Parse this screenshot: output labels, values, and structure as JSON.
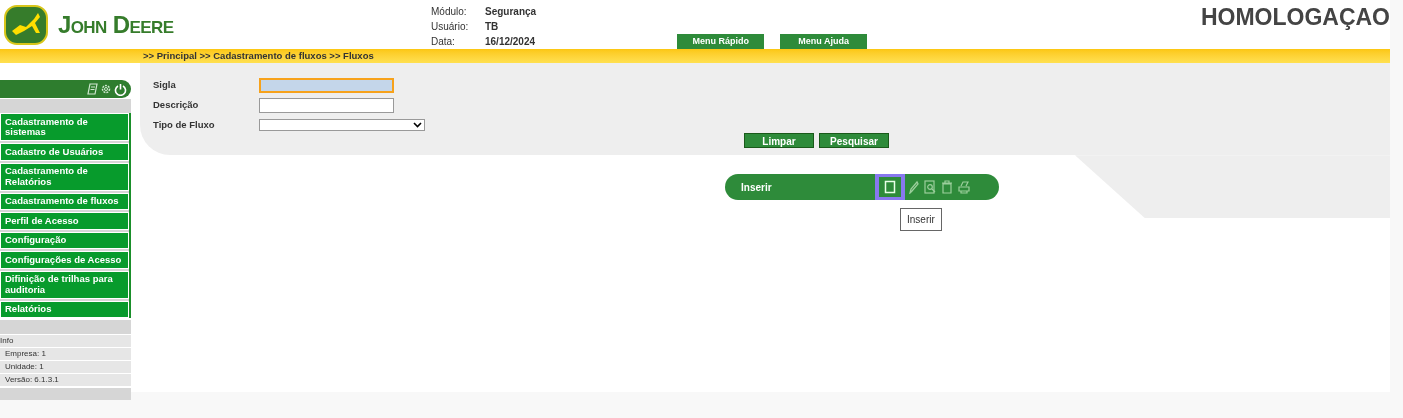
{
  "header": {
    "brand": "John Deere",
    "env": "HOMOLOGAÇAO",
    "info": [
      {
        "label": "Módulo:",
        "value": "Segurança"
      },
      {
        "label": "Usuário:",
        "value": "TB"
      },
      {
        "label": "Data:",
        "value": "16/12/2024"
      }
    ],
    "buttons": [
      "Menu Rápido",
      "Menu Ajuda"
    ]
  },
  "breadcrumb": ">> Principal >> Cadastramento de fluxos >> Fluxos",
  "sidebar": {
    "menu": [
      "Cadastramento de sistemas",
      "Cadastro de Usuários",
      "Cadastramento de Relatórios",
      "Cadastramento de fluxos",
      "Perfil de Acesso",
      "Configuração",
      "Configurações de Acesso",
      "Difinição de trilhas para auditoria",
      "Relatórios"
    ],
    "info_title": "Info",
    "info": [
      "Empresa: 1",
      "Unidade: 1",
      "Versão: 6.1.3.1"
    ]
  },
  "form": {
    "fields": [
      {
        "label": "Sigla",
        "kind": "text",
        "focused": true
      },
      {
        "label": "Descrição",
        "kind": "text",
        "focused": false
      },
      {
        "label": "Tipo de Fluxo",
        "kind": "select",
        "focused": false
      }
    ],
    "buttons": [
      "Limpar",
      "Pesquisar"
    ]
  },
  "toolbar": {
    "label": "Inserir",
    "icons": [
      {
        "kind": "insert",
        "focused": true
      },
      {
        "kind": "edit",
        "focused": false
      },
      {
        "kind": "view",
        "focused": false
      },
      {
        "kind": "delete",
        "focused": false
      },
      {
        "kind": "print",
        "focused": false
      }
    ],
    "tooltip": "Inserir"
  }
}
